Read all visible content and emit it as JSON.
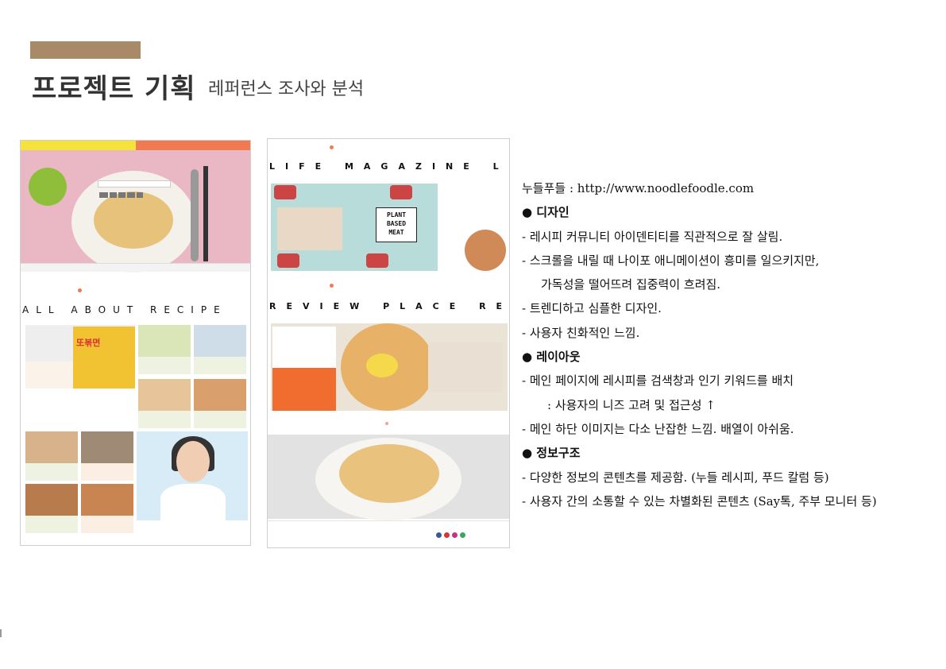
{
  "page": {
    "title": "프로젝트 기획",
    "subtitle": "레퍼런스 조사와 분석",
    "accent_color": "#a88a68"
  },
  "shot1": {
    "section_label": "ALL ABOUT RECIPE",
    "card_labels": {
      "big_card": "또볶면",
      "plant_based_sign": "PLANT BASED MEAT"
    }
  },
  "shot2": {
    "section1_label": "LIFE MAGAZINE LIF",
    "section2_label": "REVIEW PLACE REVI",
    "plant_sign": [
      "PLANT",
      "BASED",
      "MEAT"
    ]
  },
  "notes": [
    {
      "text": "누들푸들 : http://www.noodlefoodle.com",
      "kind": "plain"
    },
    {
      "text": "● 디자인",
      "kind": "sec"
    },
    {
      "text": "- 레시피 커뮤니티 아이덴티티를 직관적으로 잘 살림.",
      "kind": "plain"
    },
    {
      "text": "- 스크롤을 내릴 때 나이포 애니메이션이 흥미를 일으키지만,",
      "kind": "plain"
    },
    {
      "text": "가독성을 떨어뜨려 집중력이 흐려짐.",
      "kind": "ind1"
    },
    {
      "text": "- 트렌디하고 심플한 디자인.",
      "kind": "plain"
    },
    {
      "text": "- 사용자 친화적인 느낌.",
      "kind": "plain"
    },
    {
      "text": "● 레이아웃",
      "kind": "sec"
    },
    {
      "text": "- 메인 페이지에 레시피를 검색창과 인기 키워드를 배치",
      "kind": "plain"
    },
    {
      "text": ": 사용자의 니즈 고려 및 접근성 ↑",
      "kind": "ind2"
    },
    {
      "text": "- 메인 하단 이미지는 다소 난잡한 느낌. 배열이 아쉬움.",
      "kind": "plain"
    },
    {
      "text": "● 정보구조",
      "kind": "sec"
    },
    {
      "text": "- 다양한 정보의 콘텐츠를 제공함. (누들 레시피, 푸드 칼럼 등)",
      "kind": "plain"
    },
    {
      "text": "- 사용자 간의 소통할 수 있는 차별화된 콘텐츠 (Say톡, 주부 모니터 등)",
      "kind": "plain"
    }
  ]
}
